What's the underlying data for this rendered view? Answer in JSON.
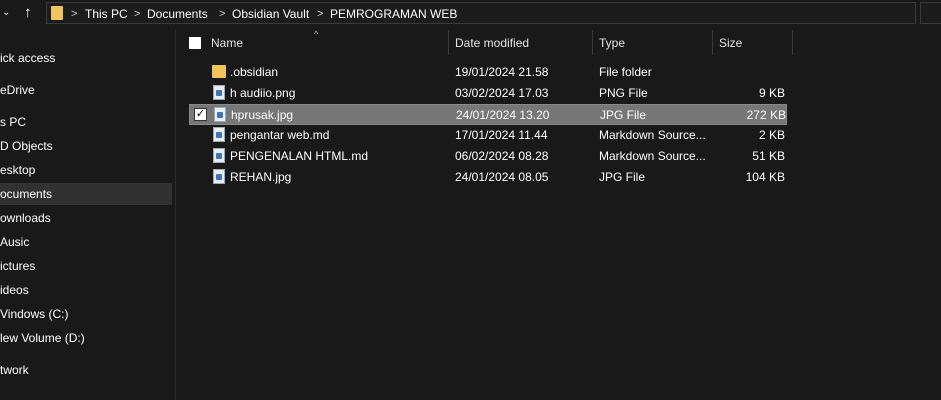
{
  "address_bar": {
    "chevron_icon": "chevron-down-icon",
    "up_icon": "arrow-up-icon",
    "folder_icon": "folder-icon",
    "crumbs": [
      "This PC",
      "Documents",
      "Obsidian Vault",
      "PEMROGRAMAN WEB"
    ],
    "separator": ">",
    "dropdown_icon": "chevron-down-icon",
    "refresh_icon": "refresh-icon"
  },
  "sidebar": {
    "items": [
      {
        "label": "ick access"
      },
      {
        "label": "eDrive"
      },
      {
        "label": "s PC"
      },
      {
        "label": "D Objects"
      },
      {
        "label": "esktop"
      },
      {
        "label": "ocuments",
        "selected": true
      },
      {
        "label": "ownloads"
      },
      {
        "label": "Ausic"
      },
      {
        "label": "ictures"
      },
      {
        "label": "ideos"
      },
      {
        "label": "Vindows (C:)"
      },
      {
        "label": "lew Volume (D:)"
      },
      {
        "label": "twork"
      }
    ]
  },
  "columns": {
    "name": "Name",
    "date": "Date modified",
    "type": "Type",
    "size": "Size",
    "sort_arrow": "^"
  },
  "files": [
    {
      "name": ".obsidian",
      "date": "19/01/2024 21.58",
      "type": "File folder",
      "size": "",
      "icon": "folder-icon"
    },
    {
      "name": "h audiio.png",
      "date": "03/02/2024 17.03",
      "type": "PNG File",
      "size": "9 KB",
      "icon": "image-file-icon"
    },
    {
      "name": "hprusak.jpg",
      "date": "24/01/2024 13.20",
      "type": "JPG File",
      "size": "272 KB",
      "icon": "image-file-icon",
      "selected": true
    },
    {
      "name": "pengantar web.md",
      "date": "17/01/2024 11.44",
      "type": "Markdown Source...",
      "size": "2 KB",
      "icon": "markdown-file-icon"
    },
    {
      "name": "PENGENALAN HTML.md",
      "date": "06/02/2024 08.28",
      "type": "Markdown Source...",
      "size": "51 KB",
      "icon": "markdown-file-icon"
    },
    {
      "name": "REHAN.jpg",
      "date": "24/01/2024 08.05",
      "type": "JPG File",
      "size": "104 KB",
      "icon": "image-file-icon"
    }
  ],
  "colors": {
    "background": "#191919",
    "selection": "#777777",
    "sidebar_selection": "#313131",
    "folder": "#f2c55c"
  }
}
